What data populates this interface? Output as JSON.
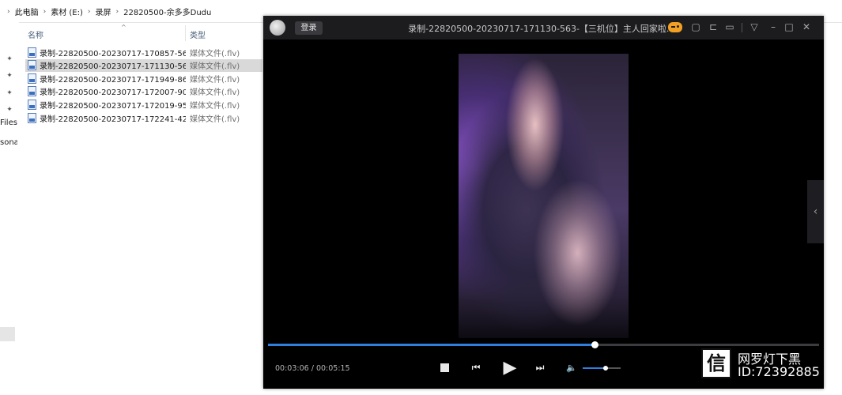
{
  "explorer": {
    "breadcrumbs": [
      "此电脑",
      "素材 (E:)",
      "录屏",
      "22820500-余多多Dudu"
    ],
    "nav_pane": {
      "labels": [
        "Files",
        "sona"
      ]
    },
    "columns": {
      "name": "名称",
      "type": "类型"
    },
    "files": [
      {
        "name": "录制-22820500-20230717-170857-56...",
        "type": "媒体文件(.flv)",
        "selected": false
      },
      {
        "name": "录制-22820500-20230717-171130-56...",
        "type": "媒体文件(.flv)",
        "selected": true
      },
      {
        "name": "录制-22820500-20230717-171949-86...",
        "type": "媒体文件(.flv)",
        "selected": false
      },
      {
        "name": "录制-22820500-20230717-172007-90...",
        "type": "媒体文件(.flv)",
        "selected": false
      },
      {
        "name": "录制-22820500-20230717-172019-95...",
        "type": "媒体文件(.flv)",
        "selected": false
      },
      {
        "name": "录制-22820500-20230717-172241-42...",
        "type": "媒体文件(.flv)",
        "selected": false
      }
    ]
  },
  "player": {
    "login_label": "登录",
    "title": "录制-22820500-20230717-171130-563-【三机位】主人回家啦.flv",
    "current_time": "00:03:06",
    "time_separator": "/",
    "total_time": "00:05:15",
    "progress_fraction": 0.593,
    "volume_fraction": 0.6,
    "accent_color": "#2f7fe0",
    "titlebar_icons": [
      "game-controller-icon",
      "mini-mode-icon",
      "pin-icon",
      "folder-icon",
      "menu-dropdown-icon",
      "minimize-icon",
      "maximize-icon",
      "close-icon"
    ]
  },
  "watermark": {
    "logo_glyph": "信",
    "line1": "网罗灯下黑",
    "line2": "ID:72392885"
  }
}
